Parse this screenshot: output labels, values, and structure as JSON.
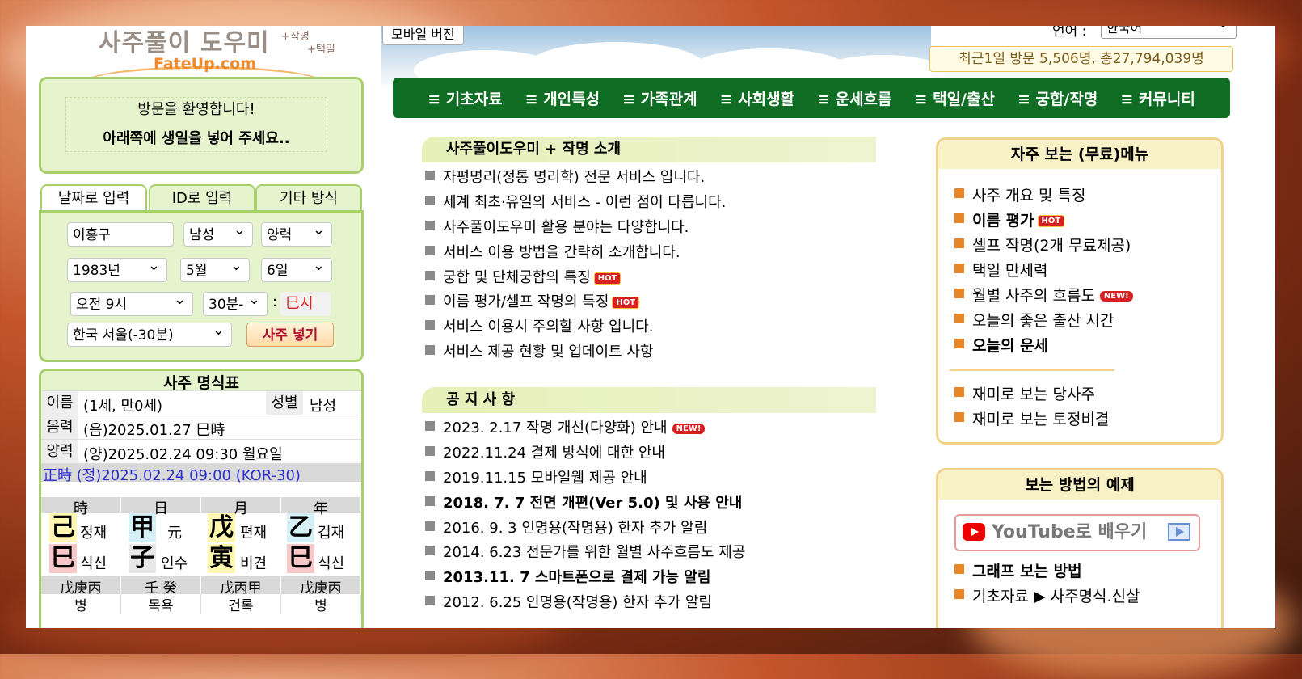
{
  "header": {
    "logo_text": "사주풀이 도우미",
    "logo_sub1": "+작명",
    "logo_sub2": "+택일",
    "logo_url": "FateUp.com",
    "mobile_button": "모바일 버전",
    "language_label": "언어 :",
    "language_value": "한국어",
    "visits": "최근1일 방문 5,506명, 총27,794,039명"
  },
  "nav": [
    "≡ 기초자료",
    "≡ 개인특성",
    "≡ 가족관계",
    "≡ 사회생활",
    "≡ 운세흐름",
    "≡ 택일/출산",
    "≡ 궁합/작명",
    "≡ 커뮤니티"
  ],
  "welcome": {
    "line1": "방문을 환영합니다!",
    "line2": "아래쪽에 생일을 넣어 주세요.."
  },
  "input_tabs": [
    "날짜로 입력",
    "ID로 입력",
    "기타 방식"
  ],
  "form": {
    "name": "이홍구",
    "gender": "남성",
    "calendar": "양력",
    "year": "1983년",
    "month": "5월",
    "day": "6일",
    "hour": "오전 9시",
    "minute": "30분-",
    "colon": ":",
    "sinsi": "巳시",
    "region": "한국 서울(-30분)",
    "submit": "사주 넣기"
  },
  "myeong": {
    "title": "사주 명식표",
    "name_label": "이름",
    "name_value": "(1세, 만0세)",
    "gender_label": "성별",
    "gender_value": "남성",
    "lunar_label": "음력",
    "lunar_value": "(음)2025.01.27 巳時",
    "solar_label": "양력",
    "solar_value": "(양)2025.02.24 09:30 월요일",
    "jung_value": "正時 (정)2025.02.24 09:00 (KOR-30)",
    "pillar_heads": [
      "時",
      "日",
      "月",
      "年"
    ],
    "pillars": [
      {
        "top": "己",
        "top_sub": "정재",
        "bot": "巳",
        "bot_sub": "식신",
        "hidden": "戊庚丙",
        "stage": "병"
      },
      {
        "top": "甲",
        "top_sub": "元",
        "bot": "子",
        "bot_sub": "인수",
        "hidden": "壬 癸",
        "stage": "목욕"
      },
      {
        "top": "戊",
        "top_sub": "편재",
        "bot": "寅",
        "bot_sub": "비견",
        "hidden": "戊丙甲",
        "stage": "건록"
      },
      {
        "top": "乙",
        "top_sub": "겁재",
        "bot": "巳",
        "bot_sub": "식신",
        "hidden": "戊庚丙",
        "stage": "병"
      }
    ]
  },
  "intro": {
    "title": "사주풀이도우미 + 작명 소개",
    "items": [
      "자평명리(정통 명리학) 전문 서비스 입니다.",
      "세계 최초·유일의 서비스 - 이런 점이 다릅니다.",
      "사주풀이도우미 활용 분야는 다양합니다.",
      "서비스 이용 방법을 간략히 소개합니다.",
      "궁합 및 단체궁합의 특징",
      "이름 평가/셀프 작명의 특징",
      "서비스 이용시 주의할 사항 입니다.",
      "서비스 제공 현황 및 업데이트 사항"
    ]
  },
  "notice": {
    "title": "공 지 사 항",
    "items": [
      "2023. 2.17 작명 개선(다양화) 안내",
      "2022.11.24 결제 방식에 대한 안내",
      "2019.11.15 모바일웹 제공 안내",
      "2018. 7. 7 전면 개편(Ver 5.0) 및 사용 안내",
      "2016. 9. 3 인명용(작명용) 한자 추가 알림",
      "2014. 6.23 전문가를 위한 월별 사주흐름도 제공",
      "2013.11. 7 스마트폰으로 결제 가능 알림",
      "2012. 6.25 인명용(작명용) 한자 추가 알림"
    ]
  },
  "freemenu": {
    "title": "자주 보는 (무료)메뉴",
    "items": [
      "사주 개요 및 특징",
      "이름 평가",
      "셀프 작명(2개 무료제공)",
      "택일 만세력",
      "월별 사주의 흐름도",
      "오늘의 좋은 출산 시간",
      "오늘의 운세",
      "재미로 보는 당사주",
      "재미로 보는 토정비결"
    ]
  },
  "examples": {
    "title": "보는 방법의 예제",
    "youtube_label": "YouTube로 배우기",
    "items": [
      "그래프 보는 방법",
      "기초자료 ▶ 사주명식.신살"
    ]
  },
  "badges": {
    "hot": "HOT",
    "new": "NEW!"
  },
  "colors": {
    "nav_bg": "#0f6e23",
    "green_border": "#a8d06a",
    "gold_border": "#f2d28a",
    "badge_red": "#d82020"
  }
}
